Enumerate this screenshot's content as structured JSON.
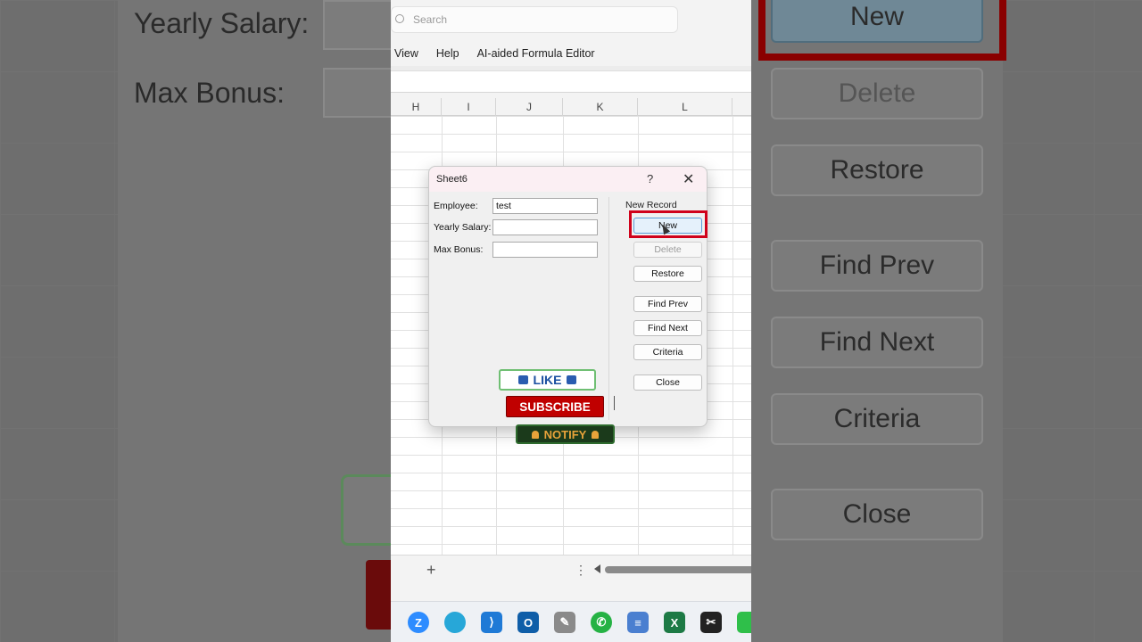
{
  "zoom_left": {
    "label_yearly": "Yearly Salary:",
    "label_bonus": "Max Bonus:"
  },
  "zoom_right": {
    "btn_new": "New",
    "btn_delete": "Delete",
    "btn_restore": "Restore",
    "btn_find_prev": "Find Prev",
    "btn_find_next": "Find Next",
    "btn_criteria": "Criteria",
    "btn_close": "Close"
  },
  "app": {
    "search_placeholder": "Search",
    "menu": [
      "View",
      "Help",
      "AI-aided Formula Editor"
    ],
    "columns": [
      "H",
      "I",
      "J",
      "K",
      "L"
    ]
  },
  "dialog": {
    "title": "Sheet6",
    "help_glyph": "?",
    "close_glyph": "✕",
    "fields": [
      {
        "label": "Employee:",
        "value": "test"
      },
      {
        "label": "Yearly Salary:",
        "value": ""
      },
      {
        "label": "Max Bonus:",
        "value": ""
      }
    ],
    "record_status": "New Record",
    "buttons": {
      "new": "New",
      "delete": "Delete",
      "restore": "Restore",
      "find_prev": "Find Prev",
      "find_next": "Find Next",
      "criteria": "Criteria",
      "close": "Close"
    }
  },
  "overlay": {
    "like": "LIKE",
    "subscribe": "SUBSCRIBE",
    "notify": "NOTIFY"
  },
  "sheet_tabs": {
    "add": "+",
    "more": "⋮"
  },
  "taskbar": {
    "apps": [
      {
        "name": "zoom",
        "glyph": "Z",
        "color": "#2d8cff"
      },
      {
        "name": "edge",
        "glyph": "",
        "color": "#27a7d8"
      },
      {
        "name": "vscode",
        "glyph": "⟩",
        "color": "#1f7ad6"
      },
      {
        "name": "outlook",
        "glyph": "O",
        "color": "#0f5ea8"
      },
      {
        "name": "tools",
        "glyph": "✎",
        "color": "#8a8a8a"
      },
      {
        "name": "whatsapp",
        "glyph": "✆",
        "color": "#25b244"
      },
      {
        "name": "notepad",
        "glyph": "≡",
        "color": "#4a7fd0"
      },
      {
        "name": "excel",
        "glyph": "X",
        "color": "#1d7a45"
      },
      {
        "name": "capcut",
        "glyph": "✂",
        "color": "#222222"
      },
      {
        "name": "green-app",
        "glyph": "",
        "color": "#2fbf4a"
      }
    ]
  }
}
